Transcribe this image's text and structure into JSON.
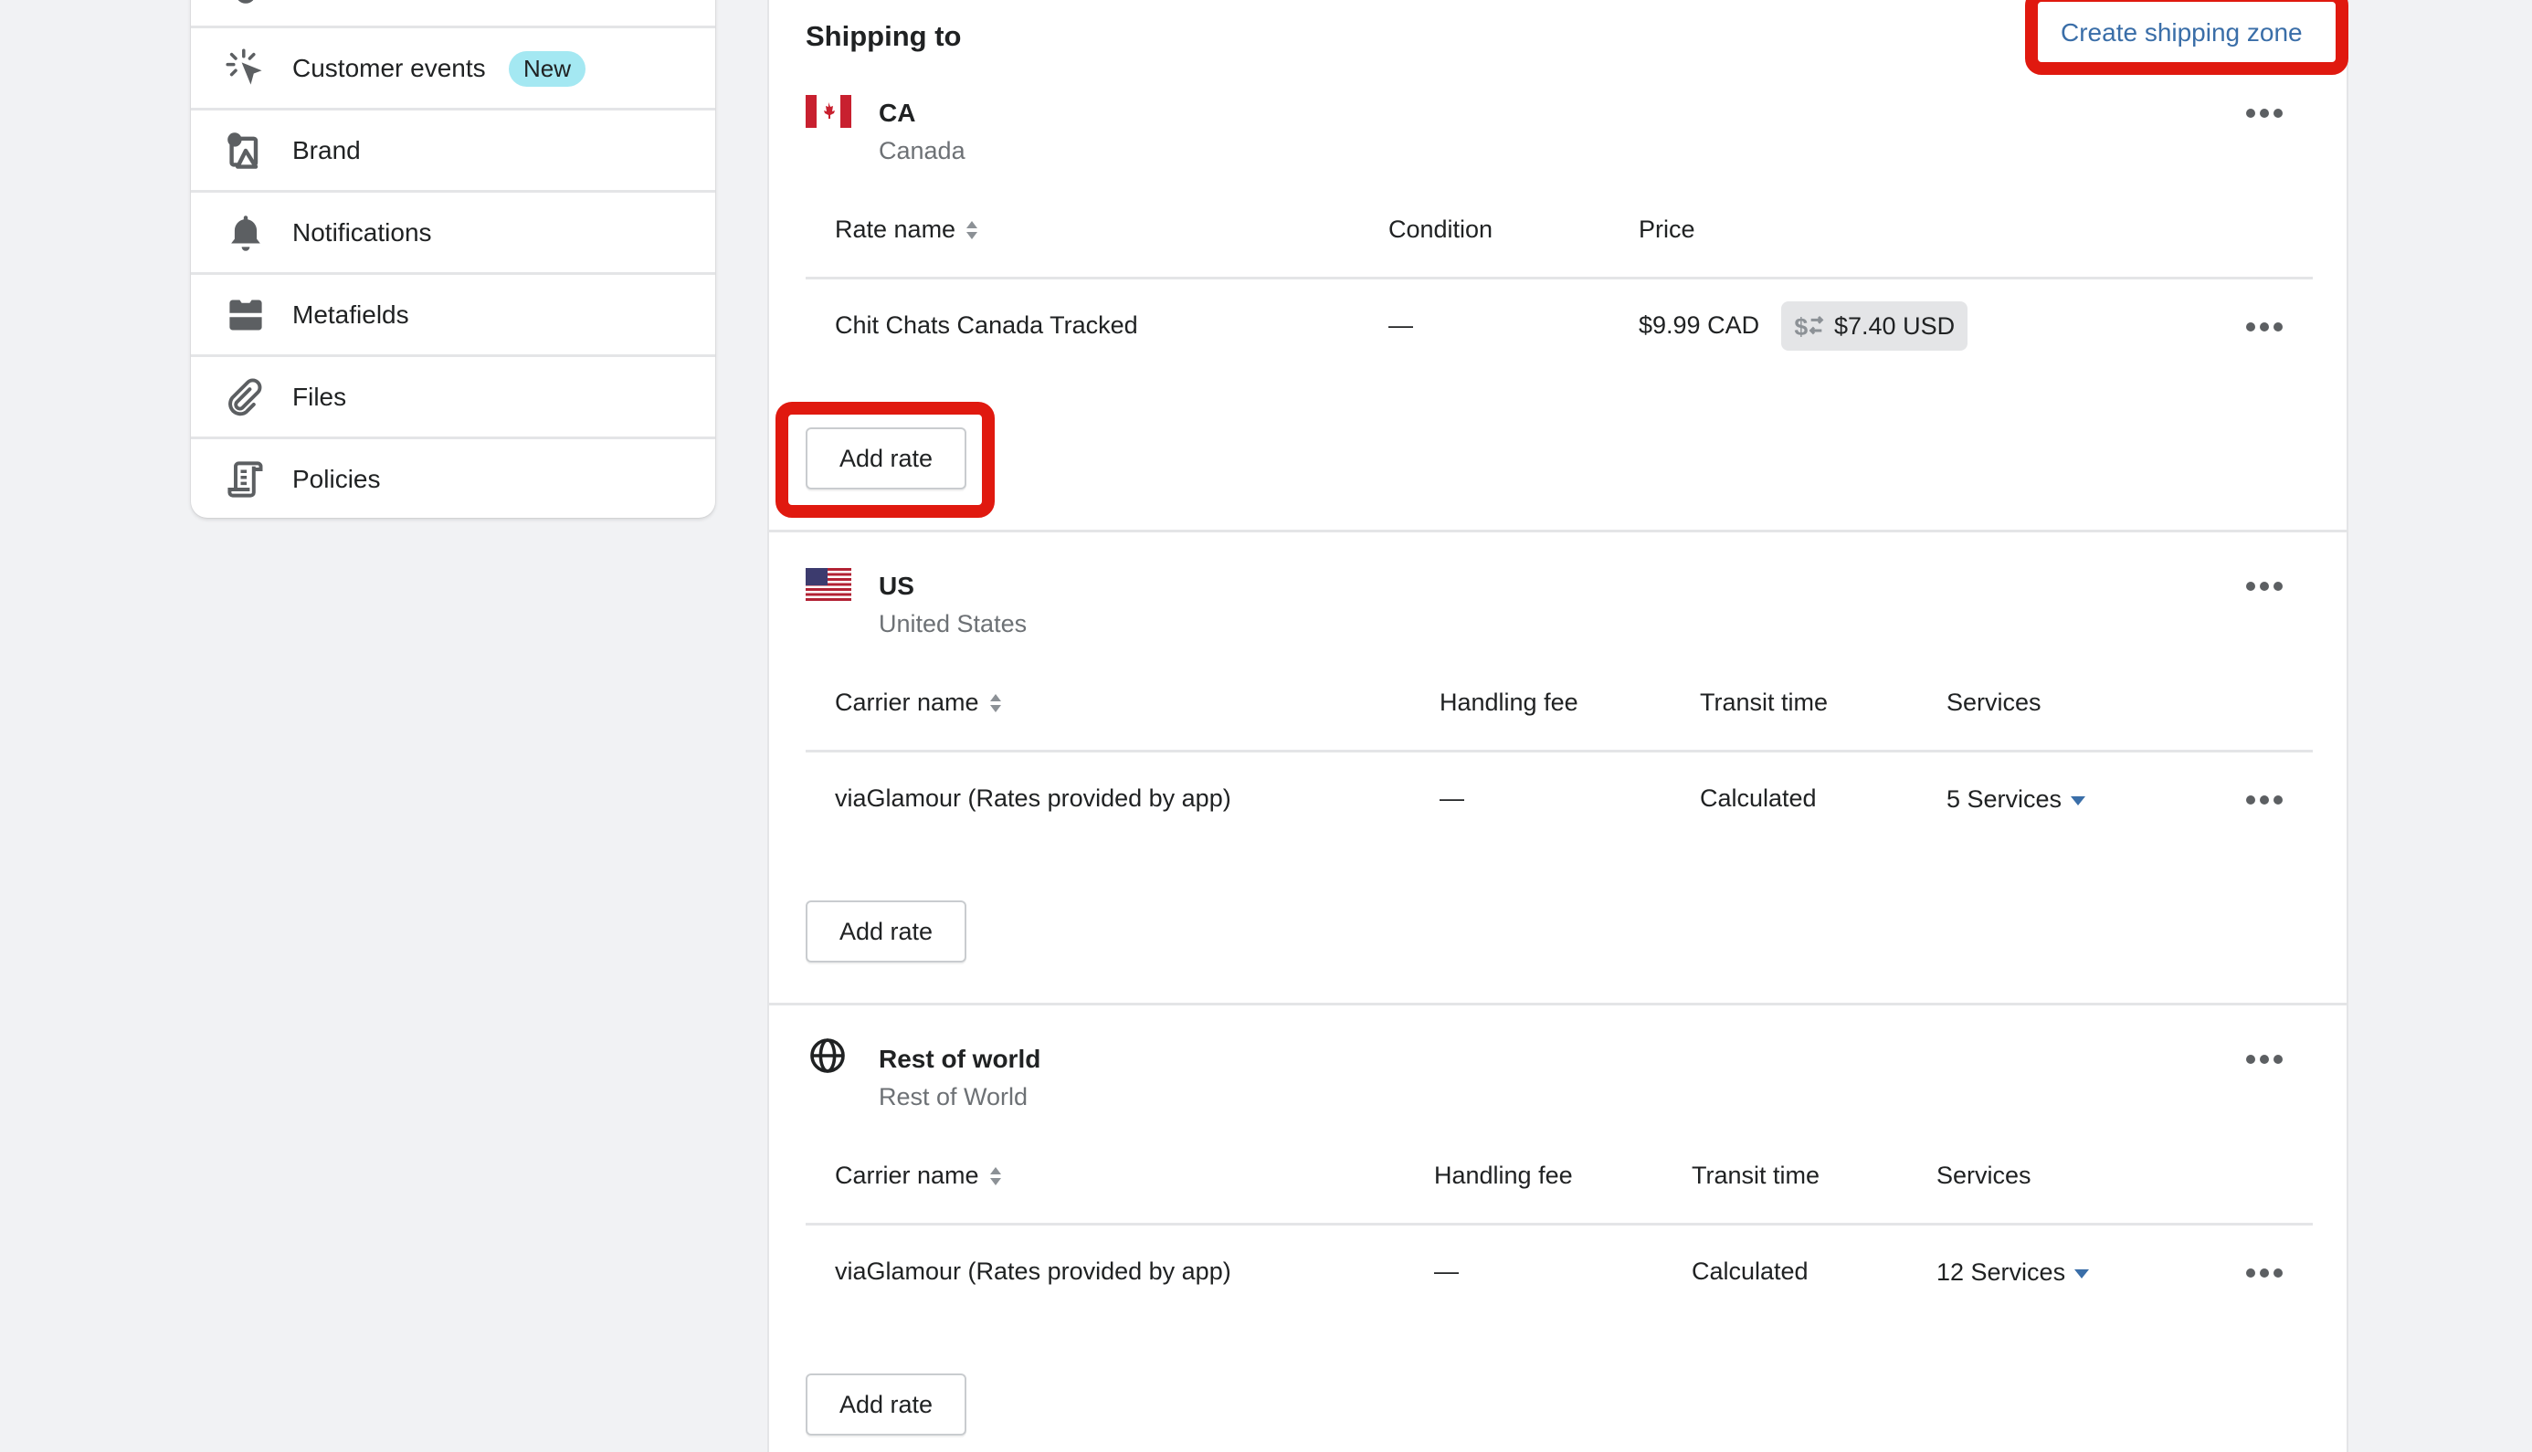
{
  "sidebar": {
    "items": [
      {
        "label": "",
        "icon": "partial-icon"
      },
      {
        "label": "Customer events",
        "icon": "cursor-click-icon",
        "badge": "New"
      },
      {
        "label": "Brand",
        "icon": "brand-icon"
      },
      {
        "label": "Notifications",
        "icon": "bell-icon"
      },
      {
        "label": "Metafields",
        "icon": "metafields-icon"
      },
      {
        "label": "Files",
        "icon": "paperclip-icon"
      },
      {
        "label": "Policies",
        "icon": "policy-scroll-icon"
      }
    ]
  },
  "main": {
    "title": "Shipping to",
    "create_zone_label": "Create shipping zone",
    "zones": [
      {
        "code": "CA",
        "name": "Canada",
        "flag": "canada-flag",
        "columns": [
          "Rate name",
          "Condition",
          "Price"
        ],
        "rows": [
          {
            "name": "Chit Chats Canada Tracked",
            "condition": "—",
            "price": "$9.99 CAD",
            "converted": "$7.40 USD"
          }
        ],
        "add_rate_label": "Add rate"
      },
      {
        "code": "US",
        "name": "United States",
        "flag": "us-flag",
        "columns": [
          "Carrier name",
          "Handling fee",
          "Transit time",
          "Services"
        ],
        "rows": [
          {
            "name": "viaGlamour (Rates provided by app)",
            "handling_fee": "—",
            "transit_time": "Calculated",
            "services": "5 Services"
          }
        ],
        "add_rate_label": "Add rate"
      },
      {
        "code": "Rest of world",
        "name": "Rest of World",
        "flag": "globe-icon",
        "columns": [
          "Carrier name",
          "Handling fee",
          "Transit time",
          "Services"
        ],
        "rows": [
          {
            "name": "viaGlamour (Rates provided by app)",
            "handling_fee": "—",
            "transit_time": "Calculated",
            "services": "12 Services"
          }
        ],
        "add_rate_label": "Add rate"
      }
    ]
  },
  "colors": {
    "highlight": "#e0190f",
    "link": "#3a6ea8",
    "badge": "#a4e8f2"
  }
}
